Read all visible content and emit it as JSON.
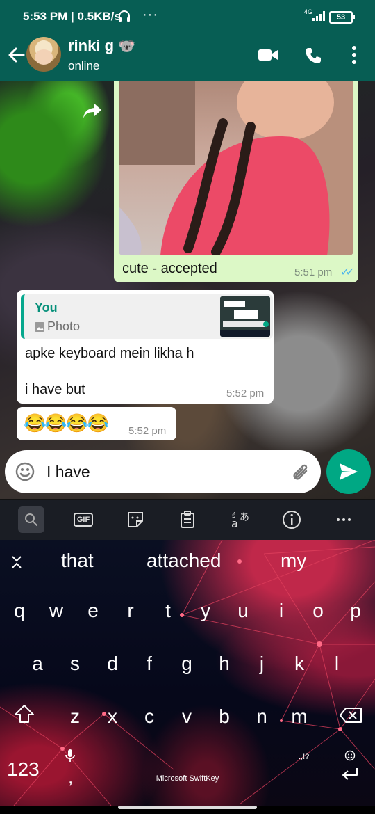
{
  "status_bar": {
    "time_speed": "5:53 PM | 0.5KB/s",
    "more": "···",
    "network": "4G",
    "battery": "53"
  },
  "header": {
    "contact_name": "rinki g",
    "contact_emoji": "🐨",
    "status": "online"
  },
  "messages": [
    {
      "type": "photo_out",
      "caption": "cute - accepted",
      "time": "5:51 pm",
      "ticks": "✓✓"
    },
    {
      "type": "reply_in",
      "quote_author": "You",
      "quote_label": "Photo",
      "line1": "apke keyboard mein likha h",
      "line2": "i have but",
      "time": "5:52 pm"
    },
    {
      "type": "emoji_in",
      "text": "😂😂😂😂",
      "time": "5:52 pm"
    }
  ],
  "composer": {
    "text": "I have"
  },
  "keyboard": {
    "toolbar": [
      "search-icon",
      "gif-icon",
      "sticker-icon",
      "clipboard-icon",
      "translate-icon",
      "info-icon",
      "more-icon"
    ],
    "gif_label": "GIF",
    "suggestions": [
      "that",
      "attached",
      "my"
    ],
    "row1": [
      "q",
      "w",
      "e",
      "r",
      "t",
      "y",
      "u",
      "i",
      "o",
      "p"
    ],
    "row2": [
      "a",
      "s",
      "d",
      "f",
      "g",
      "h",
      "j",
      "k",
      "l"
    ],
    "row3": [
      "z",
      "x",
      "c",
      "v",
      "b",
      "n",
      "m"
    ],
    "numbers_key": "123",
    "comma": ",",
    "brand": "Microsoft SwiftKey",
    "period_sym": ".,!?"
  }
}
